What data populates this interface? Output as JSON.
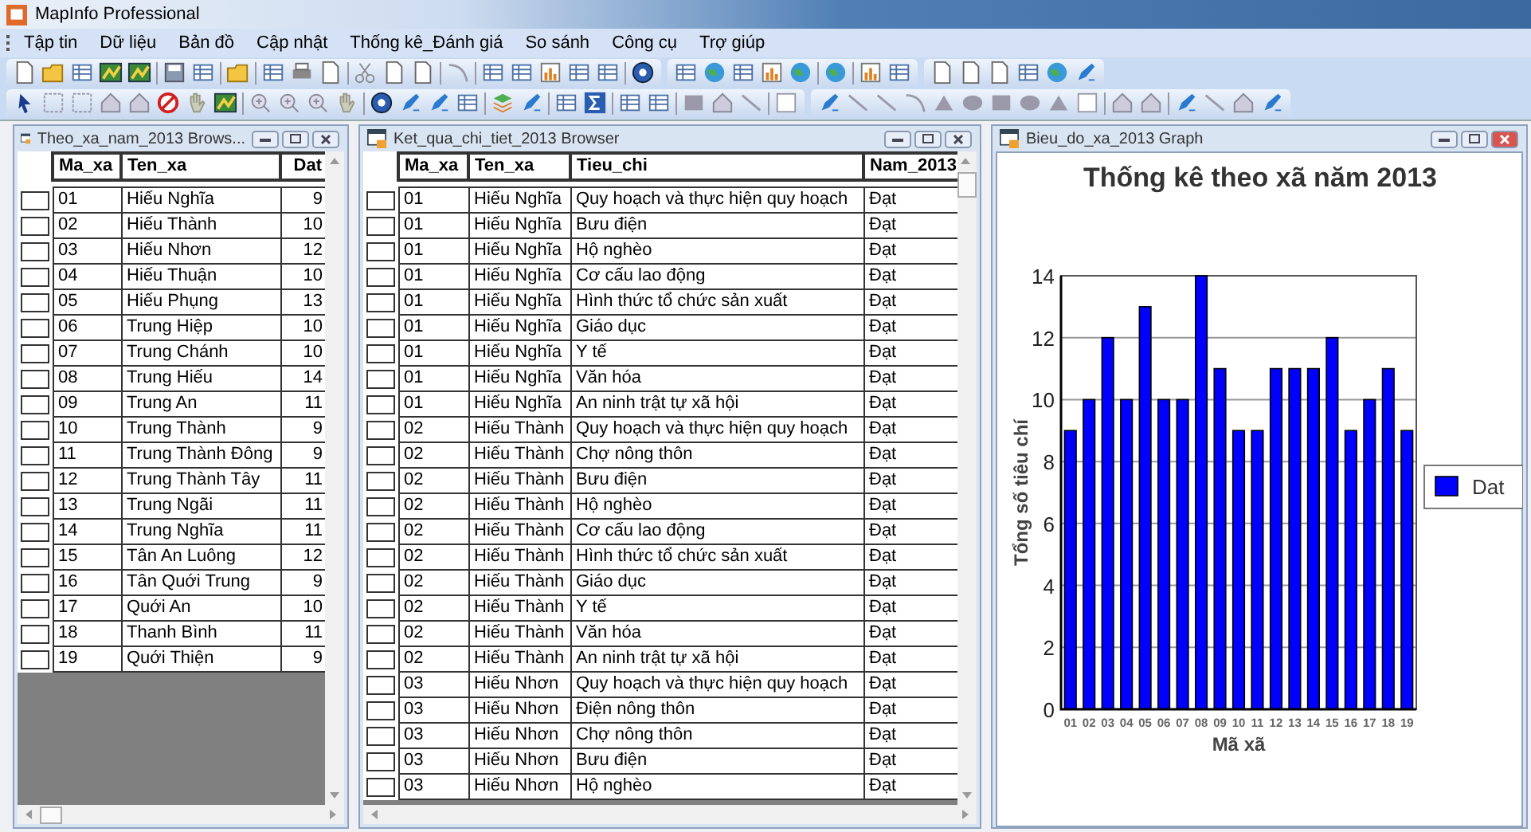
{
  "app": {
    "title": "MapInfo Professional"
  },
  "menu": [
    {
      "label": "Tập tin"
    },
    {
      "label": "Dữ liệu"
    },
    {
      "label": "Bản đồ"
    },
    {
      "label": "Cập nhật"
    },
    {
      "label": "Thống kê_Đánh giá"
    },
    {
      "label": "So sánh"
    },
    {
      "label": "Công cụ"
    },
    {
      "label": "Trợ giúp"
    }
  ],
  "windows": [
    {
      "kind": "browser",
      "title": "Theo_xa_nam_2013 Brows...",
      "active": false,
      "columns": [
        {
          "label": "Ma_xa",
          "kind": "text"
        },
        {
          "label": "Ten_xa",
          "kind": "text"
        },
        {
          "label": "Dat",
          "kind": "number"
        }
      ],
      "rows": [
        [
          "01",
          "Hiếu Nghĩa",
          "9"
        ],
        [
          "02",
          "Hiếu Thành",
          "10"
        ],
        [
          "03",
          "Hiếu Nhơn",
          "12"
        ],
        [
          "04",
          "Hiếu Thuận",
          "10"
        ],
        [
          "05",
          "Hiếu Phụng",
          "13"
        ],
        [
          "06",
          "Trung Hiệp",
          "10"
        ],
        [
          "07",
          "Trung Chánh",
          "10"
        ],
        [
          "08",
          "Trung Hiếu",
          "14"
        ],
        [
          "09",
          "Trung An",
          "11"
        ],
        [
          "10",
          "Trung Thành",
          "9"
        ],
        [
          "11",
          "Trung Thành Đông",
          "9"
        ],
        [
          "12",
          "Trung Thành Tây",
          "11"
        ],
        [
          "13",
          "Trung Ngãi",
          "11"
        ],
        [
          "14",
          "Trung Nghĩa",
          "11"
        ],
        [
          "15",
          "Tân An Luông",
          "12"
        ],
        [
          "16",
          "Tân Quới Trung",
          "9"
        ],
        [
          "17",
          "Quới An",
          "10"
        ],
        [
          "18",
          "Thanh Bình",
          "11"
        ],
        [
          "19",
          "Quới Thiện",
          "9"
        ]
      ]
    },
    {
      "kind": "browser",
      "title": "Ket_qua_chi_tiet_2013 Browser",
      "active": false,
      "columns": [
        {
          "label": "Ma_xa",
          "kind": "text"
        },
        {
          "label": "Ten_xa",
          "kind": "text"
        },
        {
          "label": "Tieu_chi",
          "kind": "text"
        },
        {
          "label": "Nam_2013",
          "kind": "text"
        }
      ],
      "rows": [
        [
          "01",
          "Hiếu Nghĩa",
          "Quy hoạch và thực hiện quy hoạch",
          "Đạt"
        ],
        [
          "01",
          "Hiếu Nghĩa",
          "Bưu điện",
          "Đạt"
        ],
        [
          "01",
          "Hiếu Nghĩa",
          "Hộ nghèo",
          "Đạt"
        ],
        [
          "01",
          "Hiếu Nghĩa",
          "Cơ cấu lao động",
          "Đạt"
        ],
        [
          "01",
          "Hiếu Nghĩa",
          "Hình thức tổ chức sản xuất",
          "Đạt"
        ],
        [
          "01",
          "Hiếu Nghĩa",
          "Giáo dục",
          "Đạt"
        ],
        [
          "01",
          "Hiếu Nghĩa",
          "Y tế",
          "Đạt"
        ],
        [
          "01",
          "Hiếu Nghĩa",
          "Văn hóa",
          "Đạt"
        ],
        [
          "01",
          "Hiếu Nghĩa",
          "An ninh trật tự xã hội",
          "Đạt"
        ],
        [
          "02",
          "Hiếu Thành",
          "Quy hoạch và thực hiện quy hoạch",
          "Đạt"
        ],
        [
          "02",
          "Hiếu Thành",
          "Chợ nông thôn",
          "Đạt"
        ],
        [
          "02",
          "Hiếu Thành",
          "Bưu điện",
          "Đạt"
        ],
        [
          "02",
          "Hiếu Thành",
          "Hộ nghèo",
          "Đạt"
        ],
        [
          "02",
          "Hiếu Thành",
          "Cơ cấu lao động",
          "Đạt"
        ],
        [
          "02",
          "Hiếu Thành",
          "Hình thức tổ chức sản xuất",
          "Đạt"
        ],
        [
          "02",
          "Hiếu Thành",
          "Giáo dục",
          "Đạt"
        ],
        [
          "02",
          "Hiếu Thành",
          "Y tế",
          "Đạt"
        ],
        [
          "02",
          "Hiếu Thành",
          "Văn hóa",
          "Đạt"
        ],
        [
          "02",
          "Hiếu Thành",
          "An ninh trật tự xã hội",
          "Đạt"
        ],
        [
          "03",
          "Hiếu Nhơn",
          "Quy hoạch và thực hiện quy hoạch",
          "Đạt"
        ],
        [
          "03",
          "Hiếu Nhơn",
          "Điện nông thôn",
          "Đạt"
        ],
        [
          "03",
          "Hiếu Nhơn",
          "Chợ nông thôn",
          "Đạt"
        ],
        [
          "03",
          "Hiếu Nhơn",
          "Bưu điện",
          "Đạt"
        ],
        [
          "03",
          "Hiếu Nhơn",
          "Hộ nghèo",
          "Đạt"
        ]
      ]
    },
    {
      "kind": "graph",
      "title": "Bieu_do_xa_2013 Graph",
      "active": true,
      "chart_data": {
        "type": "bar",
        "title": "Thống kê theo xã năm 2013",
        "xlabel": "Mã xã",
        "ylabel": "Tổng số tiêu chí",
        "categories": [
          "01",
          "02",
          "03",
          "04",
          "05",
          "06",
          "07",
          "08",
          "09",
          "10",
          "11",
          "12",
          "13",
          "14",
          "15",
          "16",
          "17",
          "18",
          "19"
        ],
        "series": [
          {
            "name": "Dat",
            "color": "#0000ff",
            "values": [
              9,
              10,
              12,
              10,
              13,
              10,
              10,
              14,
              11,
              9,
              9,
              11,
              11,
              11,
              12,
              9,
              10,
              11,
              9
            ]
          }
        ],
        "ylim": [
          0,
          14
        ],
        "yticks": [
          0,
          2,
          4,
          6,
          8,
          10,
          12,
          14
        ],
        "grid": true
      }
    }
  ]
}
